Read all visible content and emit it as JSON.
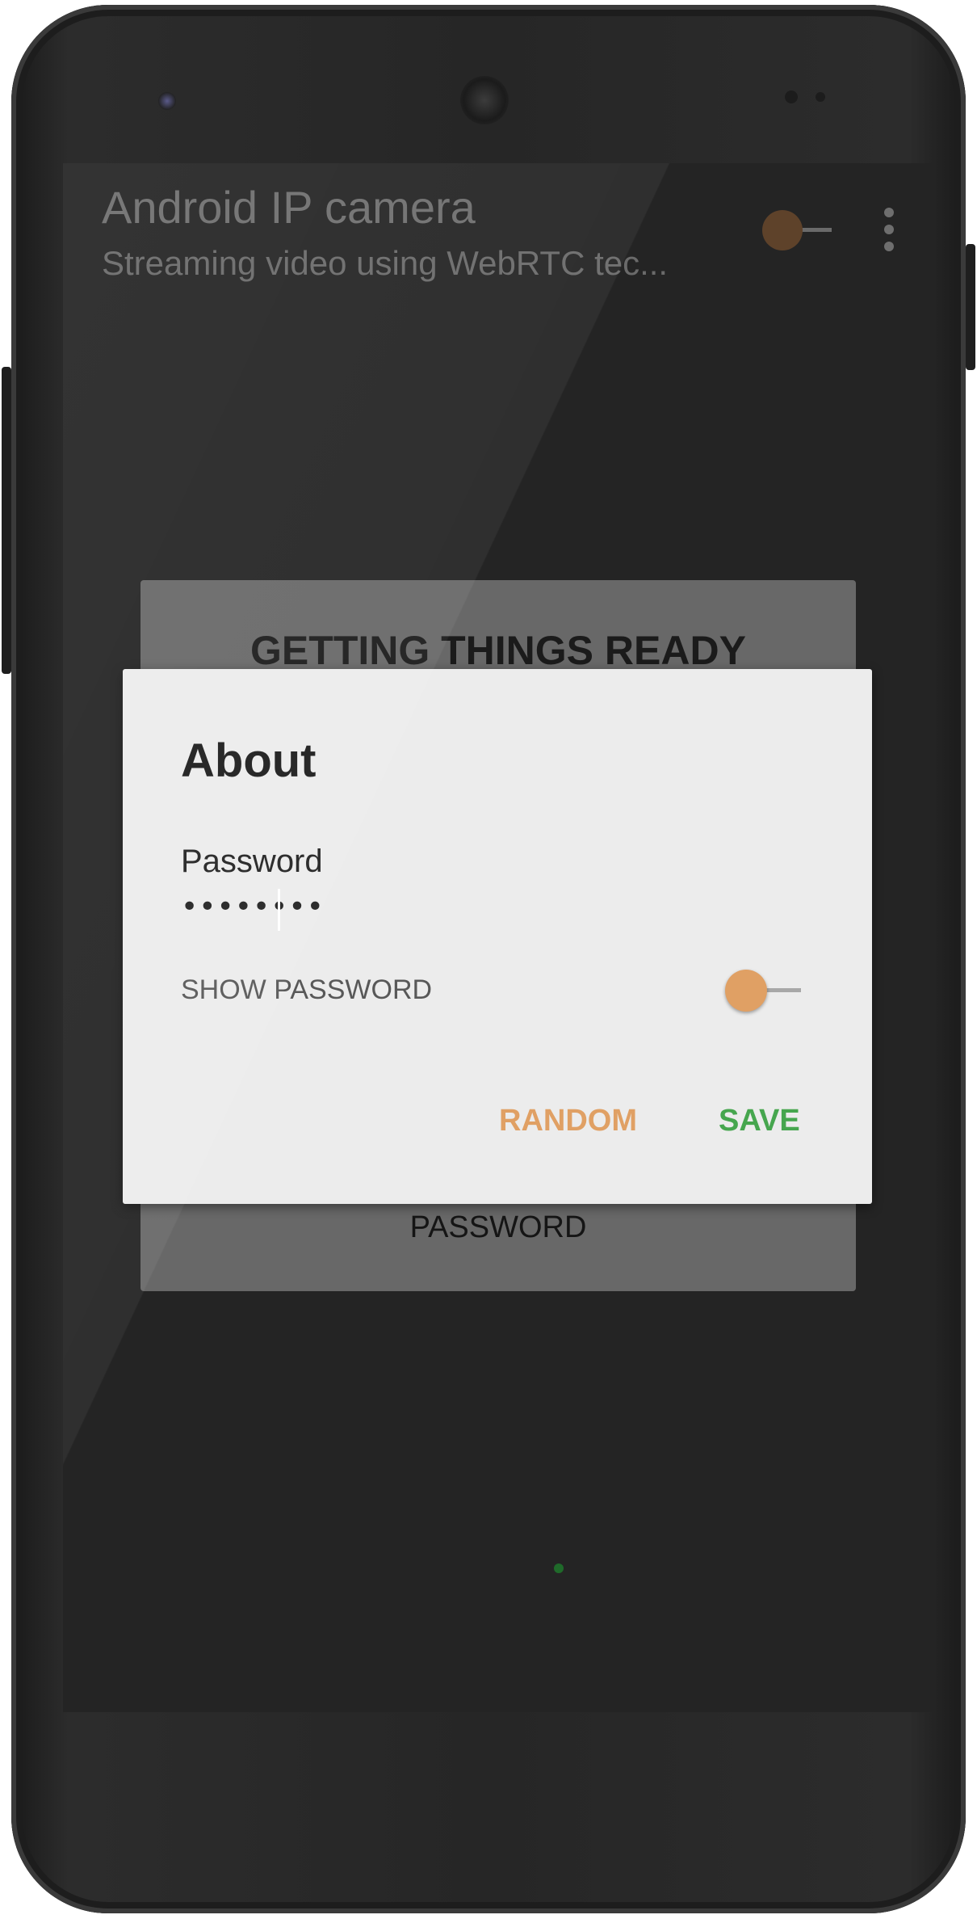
{
  "app_bar": {
    "title": "Android IP camera",
    "subtitle": "Streaming video using WebRTC tec...",
    "stream_toggle_on": false,
    "menu_icon": "overflow-menu-icon"
  },
  "background_card": {
    "title": "GETTING THINGS READY",
    "password_button": "PASSWORD"
  },
  "dialog": {
    "title": "About",
    "password_label": "Password",
    "password_value": "••••••••",
    "show_password_label": "SHOW PASSWORD",
    "show_password_on": false,
    "random_button": "RANDOM",
    "save_button": "SAVE"
  },
  "colors": {
    "accent": "#e0a064",
    "save_green": "#46a64e",
    "dialog_bg": "#ececec",
    "screen_bg": "#242424"
  }
}
